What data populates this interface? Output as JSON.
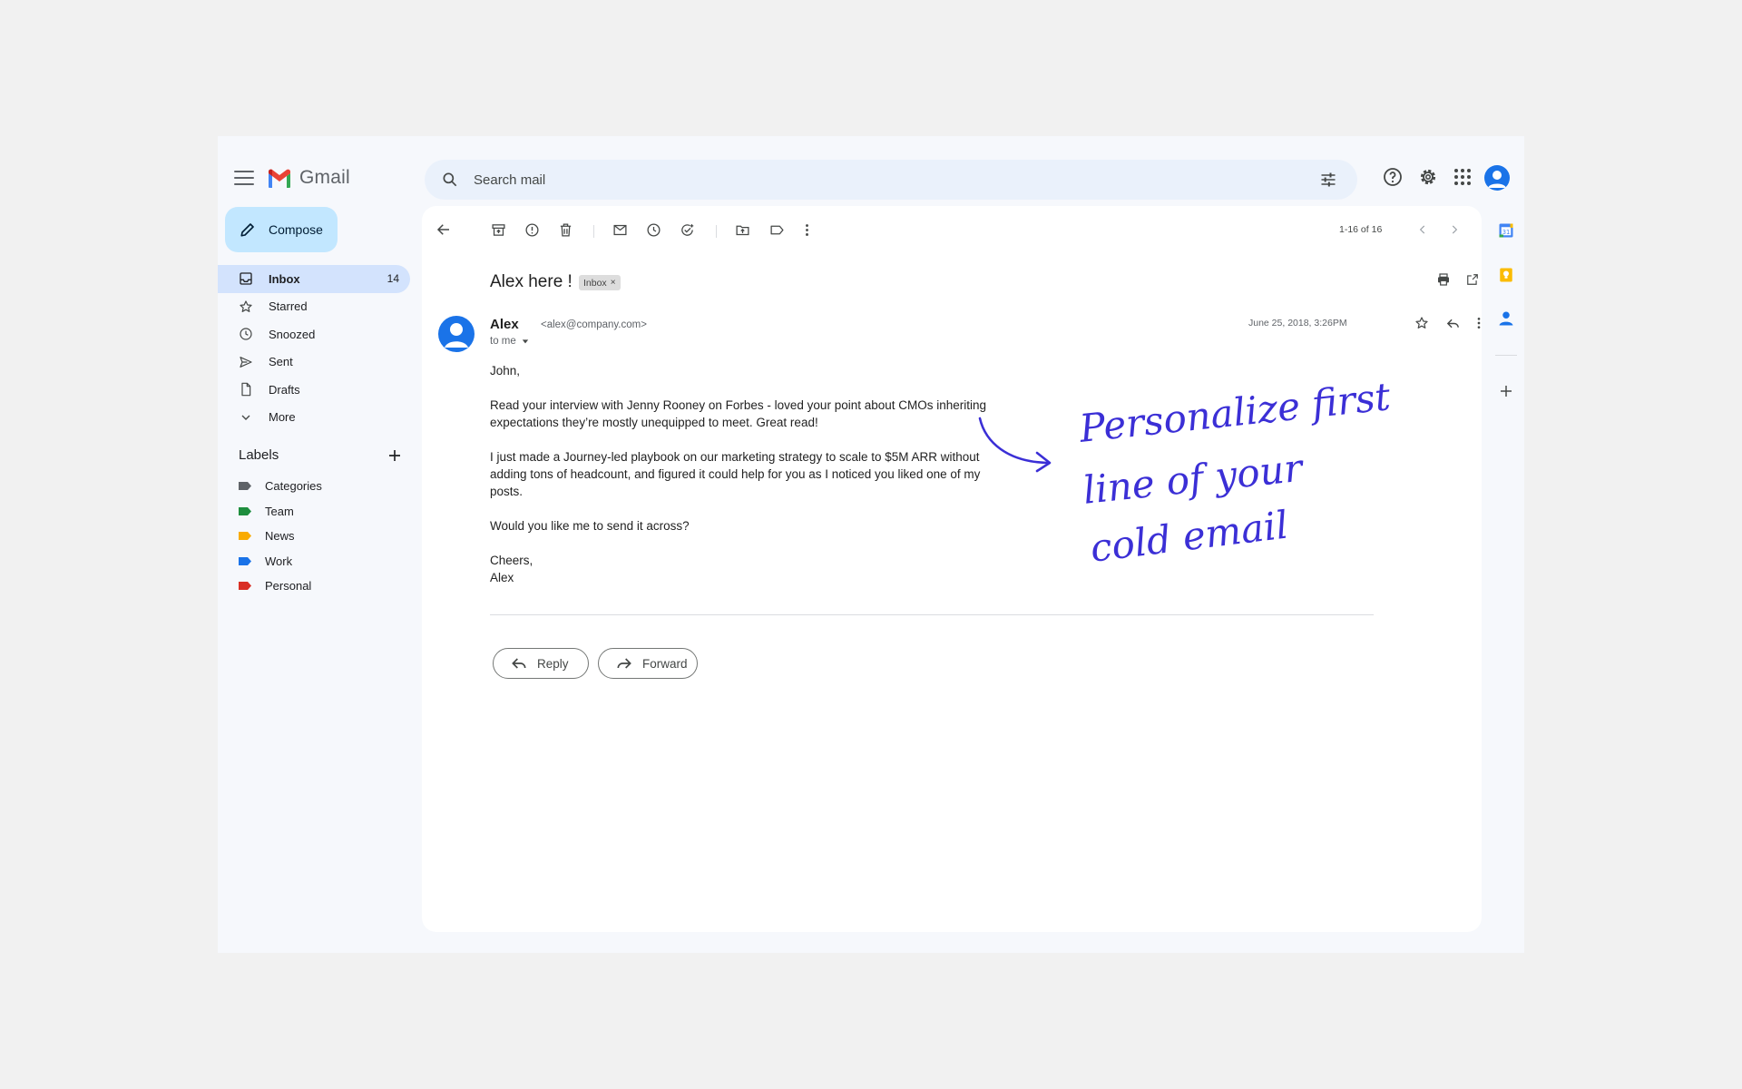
{
  "header": {
    "app_name": "Gmail",
    "search_placeholder": "Search mail"
  },
  "nav": {
    "compose_label": "Compose",
    "items": [
      {
        "label": "Inbox",
        "count": "14",
        "icon": "inbox-icon"
      },
      {
        "label": "Starred",
        "count": "",
        "icon": "star-icon"
      },
      {
        "label": "Snoozed",
        "count": "",
        "icon": "clock-icon"
      },
      {
        "label": "Sent",
        "count": "",
        "icon": "send-icon"
      },
      {
        "label": "Drafts",
        "count": "",
        "icon": "draft-icon"
      },
      {
        "label": "More",
        "count": "",
        "icon": "chevron-down-icon"
      }
    ],
    "labels_title": "Labels",
    "labels": [
      {
        "label": "Categories",
        "color": "#5f6368"
      },
      {
        "label": "Team",
        "color": "#1e8e3e"
      },
      {
        "label": "News",
        "color": "#f9ab00"
      },
      {
        "label": "Work",
        "color": "#1a73e8"
      },
      {
        "label": "Personal",
        "color": "#d93025"
      }
    ]
  },
  "toolbar": {
    "pager": "1-16 of 16"
  },
  "email": {
    "subject": "Alex here !",
    "badge": "Inbox",
    "sender_name": "Alex",
    "sender_email": "<alex@company.com>",
    "to": "to me",
    "date": "June 25, 2018, 3:26PM",
    "greeting": "John,",
    "para1": "Read your interview with Jenny Rooney on Forbes - loved your point about CMOs inheriting expectations they’re mostly unequipped to meet. Great read!",
    "para2": "I just made a Journey-led playbook on our marketing strategy to scale to $5M ARR without adding tons of headcount, and figured it could help for you as I noticed you liked one of my posts.",
    "para3": "Would you like me to send it across?",
    "signoff": "Cheers,",
    "signature": "Alex"
  },
  "actions": {
    "reply_label": "Reply",
    "forward_label": "Forward"
  },
  "annotation": {
    "line1": "Personalize first",
    "line2": "line of your",
    "line3": "cold email"
  },
  "colors": {
    "accent": "#1a73e8",
    "compose_bg": "#c2e7ff",
    "active_nav": "#d3e3fd",
    "annotation": "#3b2fd6"
  }
}
